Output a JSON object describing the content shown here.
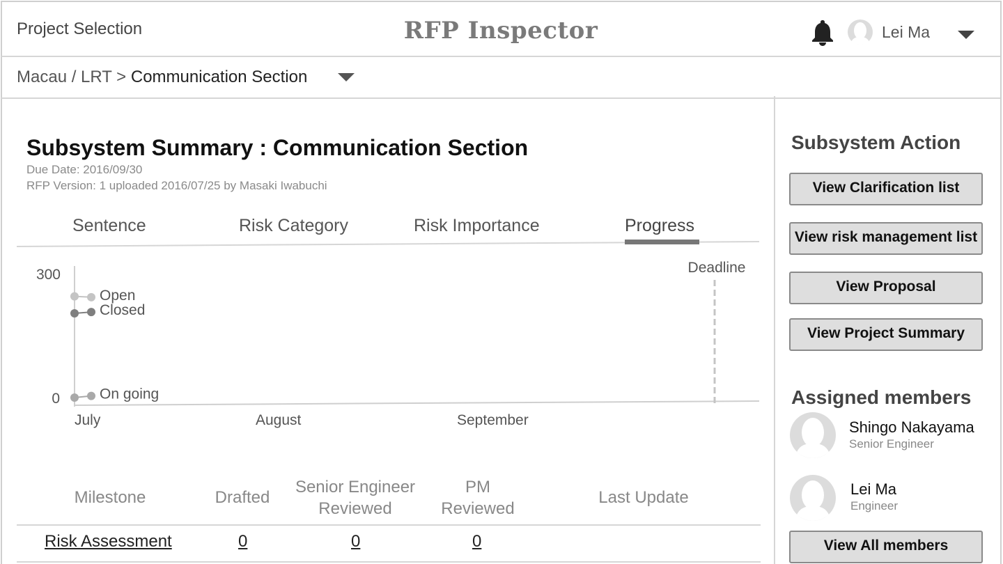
{
  "header": {
    "project_selection": "Project Selection",
    "app_title": "RFP Inspector",
    "user_name": "Lei Ma",
    "icons": [
      "bell-icon",
      "avatar-icon",
      "chevron-down-icon"
    ]
  },
  "breadcrumb": {
    "path": "Macau / LRT > ",
    "current": "Communication Section"
  },
  "summary": {
    "title": "Subsystem Summary : Communication Section",
    "due_date": "Due Date: 2016/09/30",
    "version_line": "RFP Version: 1   uploaded 2016/07/25 by Masaki Iwabuchi"
  },
  "tabs": [
    {
      "label": "Sentence"
    },
    {
      "label": "Risk Category"
    },
    {
      "label": "Risk Importance"
    },
    {
      "label": "Progress",
      "active": true
    }
  ],
  "chart_data": {
    "type": "line",
    "x_ticks": [
      "July",
      "August",
      "September"
    ],
    "y_ticks": [
      "300",
      "0"
    ],
    "ylim": [
      0,
      300
    ],
    "deadline_label": "Deadline",
    "series": [
      {
        "name": "Open",
        "color": "#c4c4c4",
        "values": [
          245,
          243
        ]
      },
      {
        "name": "Closed",
        "color": "#7f7f7f",
        "values": [
          204,
          207
        ]
      },
      {
        "name": "On going",
        "color": "#a9a9a9",
        "values": [
          0,
          4
        ]
      }
    ]
  },
  "milestones": {
    "headers": {
      "milestone": "Milestone",
      "drafted": "Drafted",
      "senior_line1": "Senior Engineer",
      "senior_line2": "Reviewed",
      "pm_line1": "PM",
      "pm_line2": "Reviewed",
      "last_update": "Last Update"
    },
    "rows": [
      {
        "milestone": "Risk Assessment",
        "drafted": "0",
        "senior_reviewed": "0",
        "pm_reviewed": "0",
        "last_update": ""
      }
    ]
  },
  "sidebar": {
    "action_title": "Subsystem Action",
    "actions": [
      {
        "label": "View Clarification list"
      },
      {
        "label": "View risk management list"
      },
      {
        "label": "View Proposal"
      },
      {
        "label": "View Project Summary"
      }
    ],
    "members_title": "Assigned members",
    "members": [
      {
        "name": "Shingo Nakayama",
        "role": "Senior Engineer"
      },
      {
        "name": "Lei Ma",
        "role": "Engineer"
      }
    ],
    "view_all_label": "View All members"
  },
  "colors": {
    "border": "#d6d6d6",
    "button_bg": "#dedede",
    "title_gray": "#7a7a7a"
  }
}
